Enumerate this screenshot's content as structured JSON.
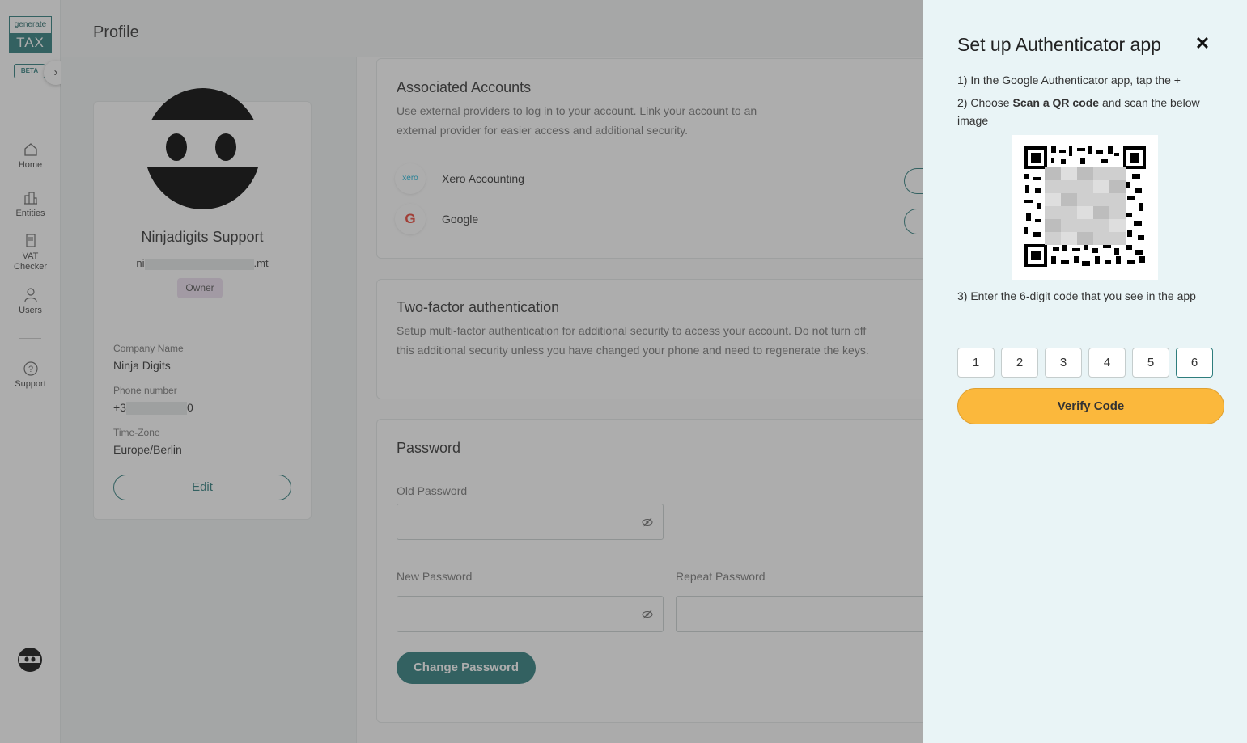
{
  "app": {
    "logo_top": "generate",
    "logo_bottom": "TAX",
    "beta": "BETA",
    "expand_icon": "›"
  },
  "sidebar": {
    "items": [
      {
        "label": "Home",
        "icon": "home-icon"
      },
      {
        "label": "Entities",
        "icon": "buildings-icon"
      },
      {
        "label": "VAT Checker",
        "icon": "document-icon"
      },
      {
        "label": "Users",
        "icon": "user-icon"
      },
      {
        "label": "Support",
        "icon": "help-icon"
      }
    ]
  },
  "page": {
    "title": "Profile"
  },
  "profile": {
    "name": "Ninjadigits Support",
    "email_start": "ni",
    "email_end": ".mt",
    "role": "Owner",
    "company_label": "Company Name",
    "company_value": "Ninja Digits",
    "phone_label": "Phone number",
    "phone_start": "+3",
    "phone_end": "0",
    "tz_label": "Time-Zone",
    "tz_value": "Europe/Berlin",
    "edit_label": "Edit"
  },
  "associated": {
    "title": "Associated Accounts",
    "desc": "Use external providers to log in to your account. Link your account to an external provider for easier access and additional security.",
    "accounts": [
      {
        "name": "Xero Accounting",
        "logo": "xero"
      },
      {
        "name": "Google",
        "logo": "G"
      }
    ]
  },
  "twofa": {
    "title": "Two-factor authentication",
    "desc": "Setup multi-factor authentication for additional security to access your account. Do not turn off this additional security unless you have changed your phone and need to regenerate the keys."
  },
  "password": {
    "title": "Password",
    "old_label": "Old Password",
    "new_label": "New Password",
    "repeat_label": "Repeat Password",
    "change_label": "Change Password"
  },
  "drawer": {
    "title": "Set up Authenticator app",
    "close_icon": "✕",
    "step1": "1) In the Google Authenticator app, tap the +",
    "step2_pre": "2) Choose ",
    "step2_bold": "Scan a QR code",
    "step2_post": " and scan the below image",
    "step3": "3) Enter the 6-digit code that you see in the app",
    "code": [
      "1",
      "2",
      "3",
      "4",
      "5",
      "6"
    ],
    "verify_label": "Verify Code"
  },
  "colors": {
    "brand": "#2e7d7d",
    "accent": "#fbb83c",
    "drawer_bg": "#e9f4f6"
  }
}
